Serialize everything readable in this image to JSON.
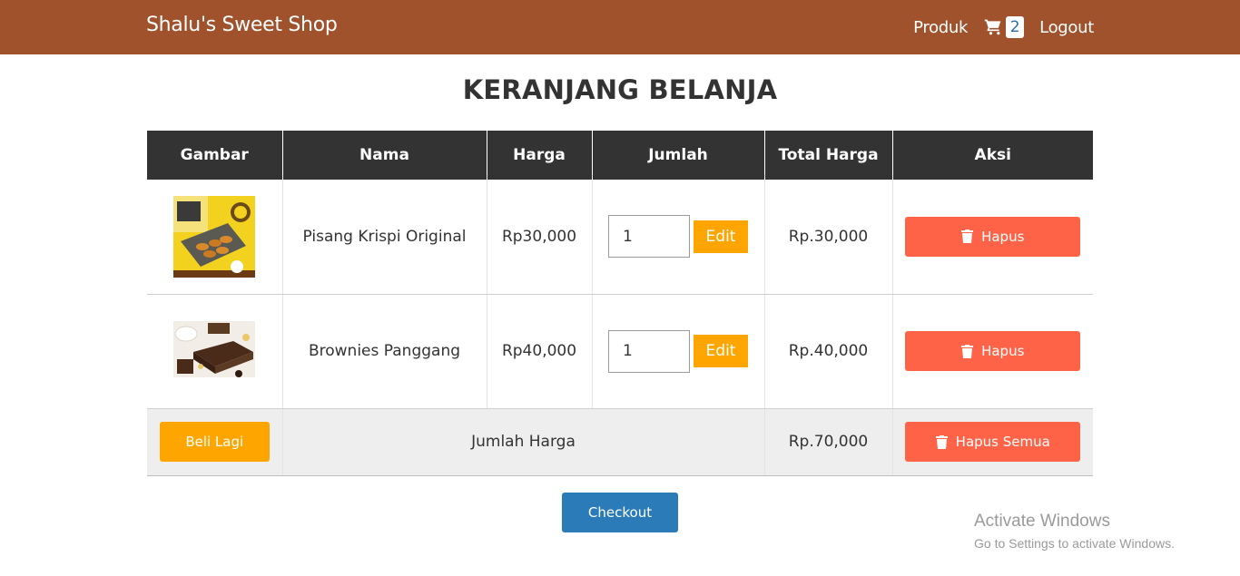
{
  "navbar": {
    "brand": "Shalu's Sweet Shop",
    "produk_label": "Produk",
    "cart_icon": "shopping-cart-icon",
    "cart_count": "2",
    "logout_label": "Logout",
    "bg_color": "#a0522d"
  },
  "page_title": "KERANJANG BELANJA",
  "table": {
    "headers": [
      "Gambar",
      "Nama",
      "Harga",
      "Jumlah",
      "Total Harga",
      "Aksi"
    ],
    "items": [
      {
        "image_icon": "pisang-krispi-product-image",
        "name": "Pisang Krispi Original",
        "price": "Rp30,000",
        "quantity": "1",
        "edit_label": "Edit",
        "total": "Rp.30,000",
        "delete_label": "Hapus"
      },
      {
        "image_icon": "brownies-panggang-product-image",
        "name": "Brownies Panggang",
        "price": "Rp40,000",
        "quantity": "1",
        "edit_label": "Edit",
        "total": "Rp.40,000",
        "delete_label": "Hapus"
      }
    ],
    "footer": {
      "buy_again_label": "Beli Lagi",
      "sum_label": "Jumlah Harga",
      "sum_total": "Rp.70,000",
      "delete_all_label": "Hapus Semua"
    }
  },
  "checkout_label": "Checkout",
  "watermark": {
    "line1": "Activate Windows",
    "line2": "Go to Settings to activate Windows."
  },
  "colors": {
    "header_bg": "#333333",
    "edit": "#ffa500",
    "delete": "#ff6347",
    "checkout": "#2b7bb9"
  }
}
